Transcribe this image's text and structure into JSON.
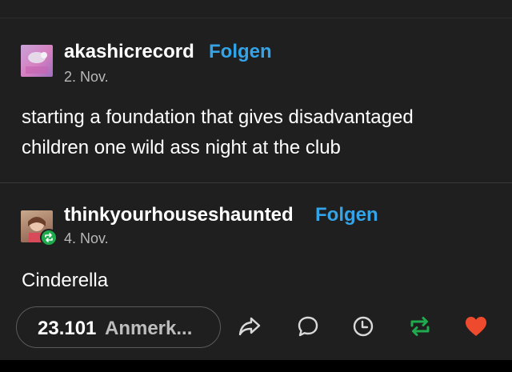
{
  "posts": [
    {
      "username": "akashicrecord",
      "follow_label": "Folgen",
      "date": "2. Nov.",
      "body_lines": [
        "starting a foundation that gives disadvantaged",
        "children one wild ass night at the club"
      ]
    },
    {
      "username": "thinkyourhouseshaunted",
      "follow_label": "Folgen",
      "date": "4. Nov.",
      "body": "Cinderella"
    }
  ],
  "footer": {
    "notes_count": "23.101",
    "notes_label": "Anmerk...",
    "icons": [
      "share-icon",
      "comment-icon",
      "clock-icon",
      "reblog-icon",
      "heart-icon"
    ],
    "colors": {
      "reblog": "#1faa4e",
      "like": "#ee4a2d",
      "link": "#33a4e8"
    }
  }
}
